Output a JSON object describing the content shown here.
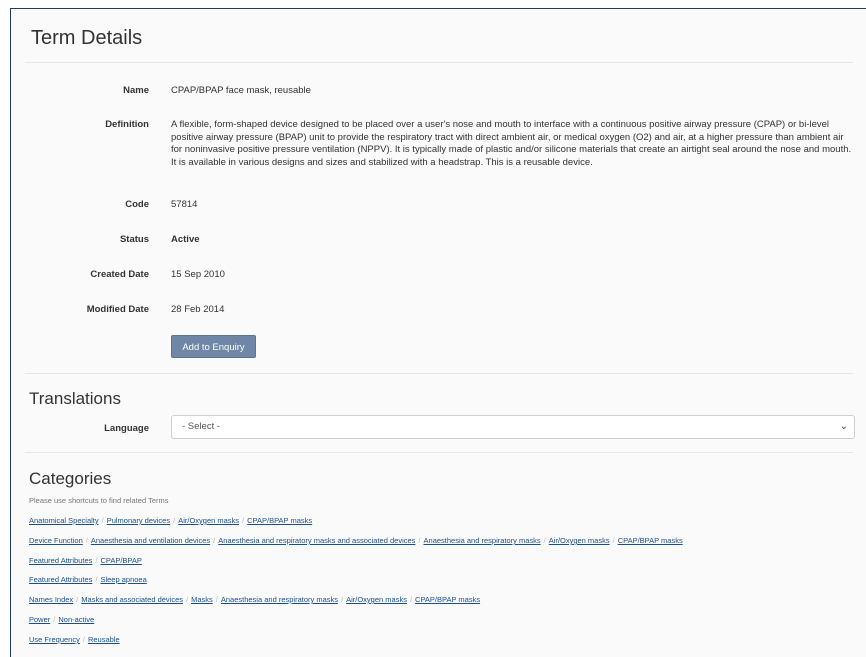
{
  "term_details": {
    "title": "Term Details",
    "fields": [
      {
        "label": "Name",
        "value": "CPAP/BPAP face mask, reusable"
      },
      {
        "label": "Definition",
        "value": "A flexible, form-shaped device designed to be placed over a user's nose and mouth to interface with a continuous positive airway pressure (CPAP) or bi-level positive airway pressure (BPAP) unit to provide the respiratory tract with direct ambient air, or medical oxygen (O2) and air, at a higher pressure than ambient air for noninvasive positive pressure ventilation (NPPV). It is typically made of plastic and/or silicone materials that create an airtight seal around the nose and mouth. It is available in various designs and sizes and stabilized with a headstrap. This is a reusable device."
      },
      {
        "label": "Code",
        "value": "57814"
      },
      {
        "label": "Status",
        "value": "Active"
      },
      {
        "label": "Created Date",
        "value": "15 Sep 2010"
      },
      {
        "label": "Modified Date",
        "value": "28 Feb 2014"
      }
    ],
    "add_button": "Add to Enquiry"
  },
  "translations": {
    "title": "Translations",
    "language_label": "Language",
    "selected": "- Select -"
  },
  "categories": {
    "title": "Categories",
    "hint": "Please use shortcuts to find related Terms",
    "paths": [
      [
        "Anatomical Specialty",
        "Pulmonary devices",
        "Air/Oxygen masks",
        "CPAP/BPAP masks"
      ],
      [
        "Device Function",
        "Anaesthesia and ventilation devices",
        "Anaesthesia and respiratory masks and associated devices",
        "Anaesthesia and respiratory masks",
        "Air/Oxygen masks",
        "CPAP/BPAP masks"
      ],
      [
        "Featured Attributes",
        "CPAP/BPAP"
      ],
      [
        "Featured Attributes",
        "Sleep apnoea"
      ],
      [
        "Names Index",
        "Masks and associated devices",
        "Masks",
        "Anaesthesia and respiratory masks",
        "Air/Oxygen masks",
        "CPAP/BPAP masks"
      ],
      [
        "Power",
        "Non-active"
      ],
      [
        "Use Frequency",
        "Reusable"
      ]
    ]
  },
  "colors": {
    "status_active": "#3c763d",
    "button": "#6f86a6",
    "link": "#1a4f8a",
    "border": "#1f3b63"
  }
}
